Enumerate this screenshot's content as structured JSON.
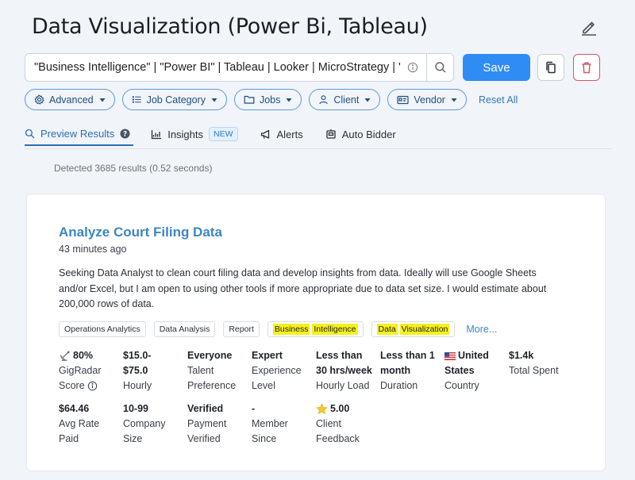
{
  "header": {
    "title": "Data Visualization (Power Bi, Tableau)"
  },
  "search": {
    "value": "\"Business Intelligence\" | \"Power BI\" | Tableau | Looker | MicroStrategy | \"Da"
  },
  "toolbar": {
    "save_label": "Save"
  },
  "filters": {
    "advanced": "Advanced",
    "job_category": "Job Category",
    "jobs": "Jobs",
    "client": "Client",
    "vendor": "Vendor",
    "reset": "Reset All"
  },
  "tabs": {
    "preview": "Preview Results",
    "insights": "Insights",
    "insights_badge": "NEW",
    "alerts": "Alerts",
    "auto_bidder": "Auto Bidder"
  },
  "results": {
    "detected": "Detected 3685 results (0.52 seconds)"
  },
  "job": {
    "title": "Analyze Court Filing Data",
    "posted": "43 minutes ago",
    "description": "Seeking Data Analyst to clean court filing data and develop insights from data. Ideally will use Google Sheets and/or Excel, but I am open to using other tools if more appropriate due to data set size. I would estimate about 200,000 rows of data.",
    "tags": {
      "t1": "Operations Analytics",
      "t2": "Data Analysis",
      "t3": "Report",
      "t4a": "Business",
      "t4b": "Intelligence",
      "t5a": "Data",
      "t5b": "Visualization",
      "more": "More..."
    },
    "stats": {
      "gigradar": {
        "value": "80%",
        "label1": "GigRadar",
        "label2": "Score"
      },
      "hourly": {
        "value1": "$15.0-",
        "value2": "$75.0",
        "label": "Hourly"
      },
      "talent": {
        "value": "Everyone",
        "label1": "Talent",
        "label2": "Preference"
      },
      "experience": {
        "value": "Expert",
        "label1": "Experience",
        "label2": "Level"
      },
      "load": {
        "value1": "Less than",
        "value2": "30 hrs/week",
        "label": "Hourly Load"
      },
      "duration": {
        "value1": "Less than 1",
        "value2": "month",
        "label": "Duration"
      },
      "country": {
        "value1": "United",
        "value2": "States",
        "label": "Country"
      },
      "spent": {
        "value": "$1.4k",
        "label": "Total Spent"
      },
      "avg_rate": {
        "value": "$64.46",
        "label1": "Avg Rate",
        "label2": "Paid"
      },
      "company": {
        "value": "10-99",
        "label1": "Company",
        "label2": "Size"
      },
      "payment": {
        "value": "Verified",
        "label1": "Payment",
        "label2": "Verified"
      },
      "member": {
        "value": "-",
        "label1": "Member",
        "label2": "Since"
      },
      "feedback": {
        "value": "5.00",
        "label1": "Client",
        "label2": "Feedback"
      }
    }
  },
  "colors": {
    "accent": "#2f8cf5",
    "link": "#3c86c0",
    "danger": "#d55865",
    "highlight": "#f6f11a"
  }
}
